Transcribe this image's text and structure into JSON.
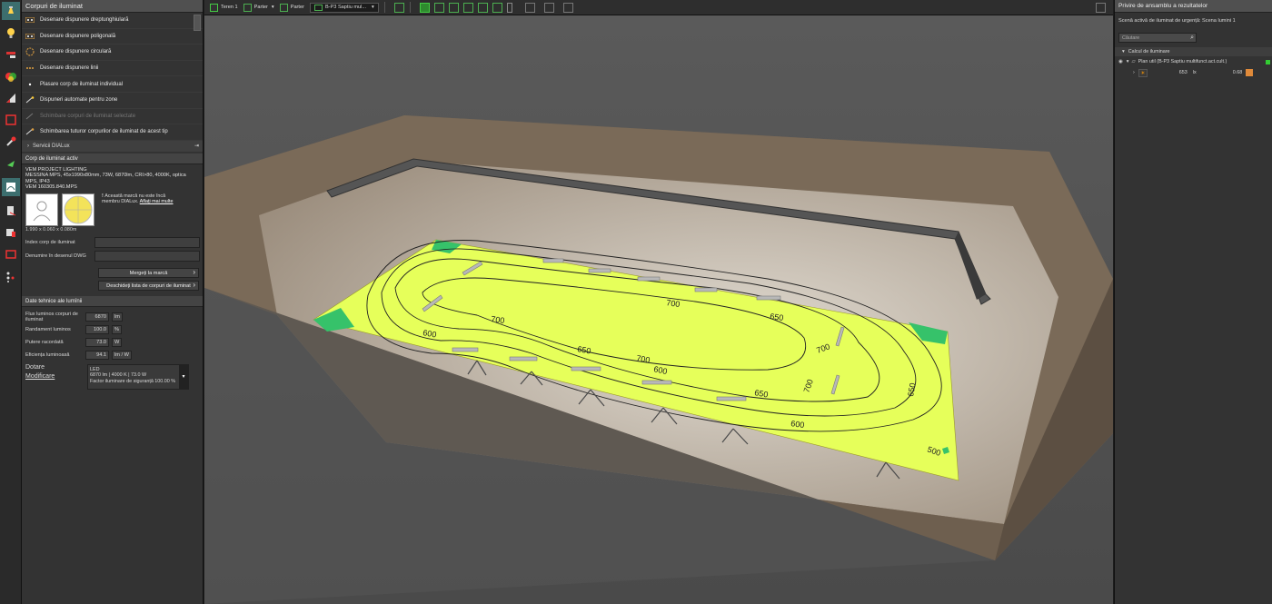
{
  "left_panel": {
    "title": "Corpuri de iluminat",
    "items": [
      {
        "label": "Desenare dispunere dreptunghiulară",
        "icon": "rect-layout-icon"
      },
      {
        "label": "Desenare dispunere poligonală",
        "icon": "polygon-layout-icon"
      },
      {
        "label": "Desenare dispunere circulară",
        "icon": "circle-layout-icon"
      },
      {
        "label": "Desenare dispunere linii",
        "icon": "line-layout-icon"
      },
      {
        "label": "Plasare corp de iluminat individual",
        "icon": "single-light-icon"
      },
      {
        "label": "Dispuneri automate pentru zone",
        "icon": "wand-icon"
      },
      {
        "label": "Schimbare corpuri de iluminat selectate",
        "icon": "swap-icon",
        "disabled": true
      },
      {
        "label": "Schimbarea tuturor corpurilor de iluminat de acest tip",
        "icon": "swap-all-icon"
      }
    ],
    "services": "Servicii DIALux",
    "active_head": "Corp de iluminat activ",
    "manufacturer": "VEM PROJECT LIGHTING",
    "product": "MESSINA MPS, 45x1990x80mm, 73W, 6870lm, CRI>80, 4000K, optica MPS, IP43",
    "code": "VEM 160305.840.MPS",
    "note": "Această marcă nu este încă membru DIALux.",
    "note_link": "Aflați mai multe",
    "dims": "1.990 x 0.060 x 0.080m",
    "index_label": "Index corp de iluminat",
    "dwg_label": "Denumire în desenul DWG",
    "btn_brand": "Mergeți la marcă",
    "btn_list": "Deschideți lista de corpuri de iluminat",
    "tech_head": "Date tehnice ale lumînii",
    "tech": [
      {
        "label": "Flux luminos corpuri de iluminat",
        "value": "6870",
        "unit": "lm"
      },
      {
        "label": "Randament luminos",
        "value": "100.0",
        "unit": "%"
      },
      {
        "label": "Putere racordată",
        "value": "73.0",
        "unit": "W"
      },
      {
        "label": "Eficiența luminoasă",
        "value": "94.1",
        "unit": "lm / W"
      }
    ],
    "dotare_label": "Dotare",
    "modificare": "Modificare",
    "dotare_lines": [
      "LED",
      "6870 lm  |  4000 K  |  73.0 W",
      "Factor iluminare de siguranță 100.00 %"
    ]
  },
  "toolbar": {
    "teren": "Teren 1",
    "parter1": "Parter",
    "parter2": "Parter",
    "room": "B-P3 Saptiu mul..."
  },
  "right_panel": {
    "title": "Privire de ansamblu a rezultatelor",
    "scene": "Scenă activă de iluminat de urgență: Scena lumini 1",
    "search_placeholder": "Căutare",
    "section": "Calcul de iluminare",
    "plane": "Plan util (B-P3 Saptiu multifunct.act.cult.)",
    "value": "653",
    "unit": "lx",
    "ratio": "0.68"
  },
  "contours": [
    "700",
    "650",
    "700",
    "600",
    "650",
    "700",
    "600",
    "650",
    "700",
    "700",
    "650",
    "600",
    "500"
  ],
  "colors": {
    "accent": "#3c6e6e",
    "plane": "#e8ff5a",
    "green": "#4caf50"
  }
}
